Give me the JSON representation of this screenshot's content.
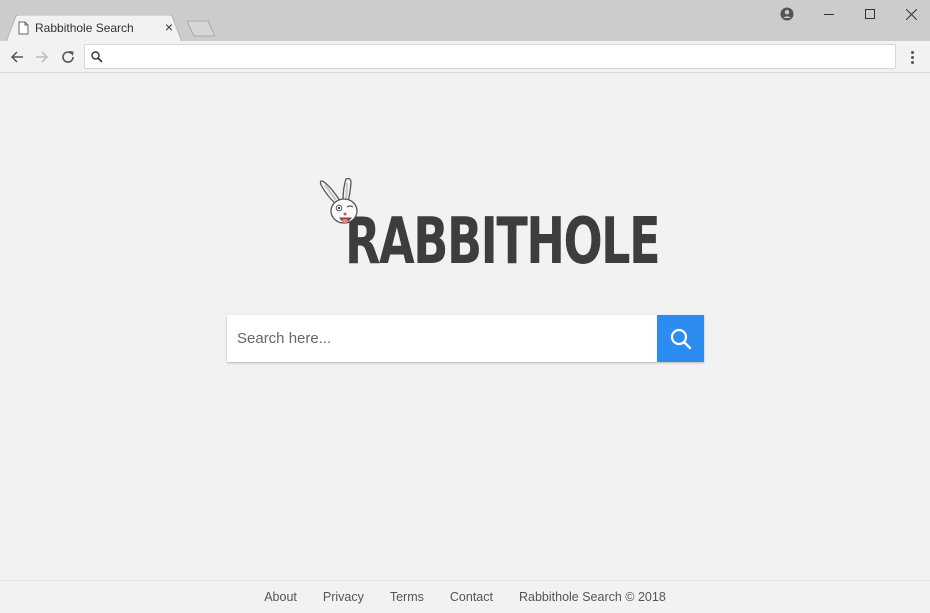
{
  "browser": {
    "tab": {
      "title": "Rabbithole Search",
      "close_glyph": "×"
    },
    "address_bar": {
      "value": "",
      "placeholder": ""
    },
    "window_controls": {
      "account": "account-icon",
      "minimize": "minimize-icon",
      "maximize": "maximize-icon",
      "close": "close-icon"
    }
  },
  "page": {
    "logo": {
      "text": "RABBITHOLE",
      "mascot": "rabbit-icon"
    },
    "search": {
      "placeholder": "Search here...",
      "value": "",
      "button_icon": "search-icon",
      "accent": "#2d8cf0"
    },
    "footer": {
      "links": [
        "About",
        "Privacy",
        "Terms",
        "Contact"
      ],
      "copyright": "Rabbithole Search © 2018"
    }
  }
}
